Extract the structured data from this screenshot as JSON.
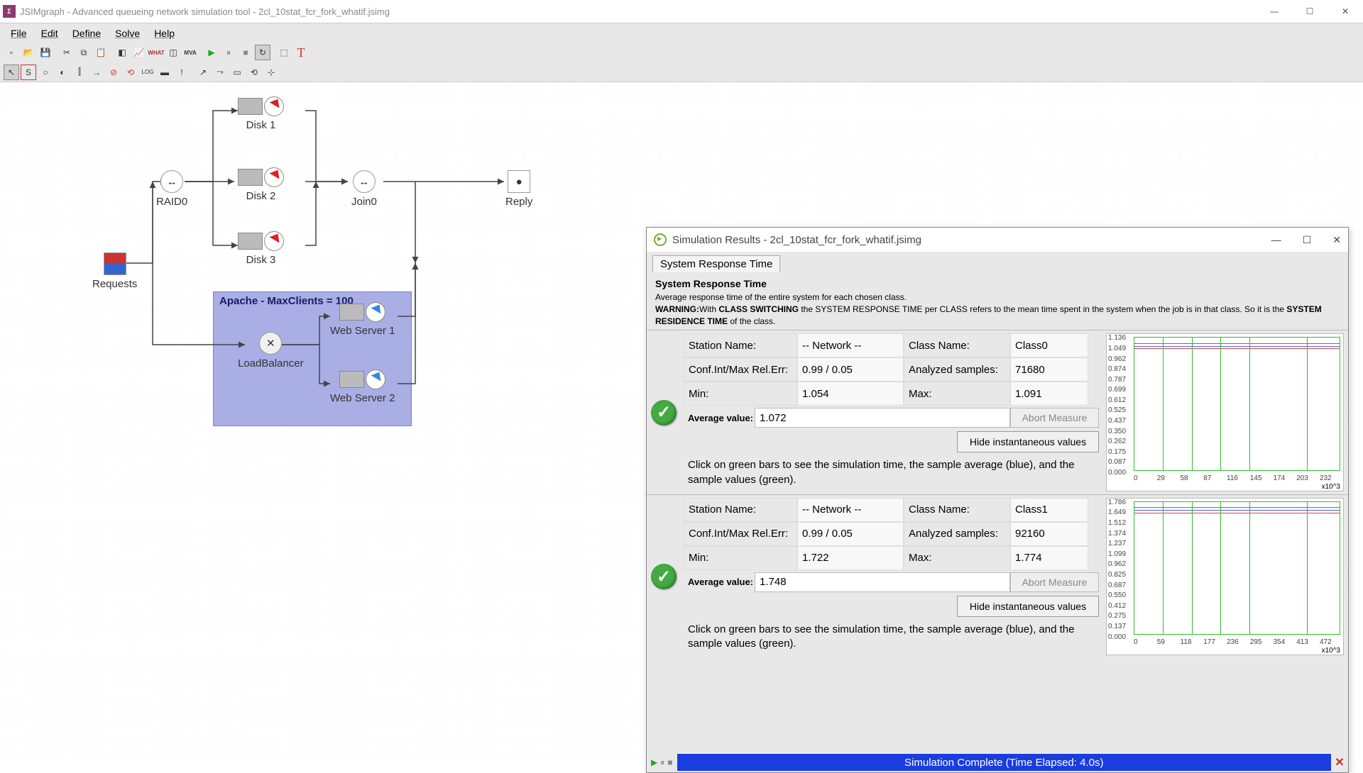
{
  "app": {
    "title": "JSIMgraph - Advanced queueing network simulation tool - 2cl_10stat_fcr_fork_whatif.jsimg"
  },
  "menu": [
    "File",
    "Edit",
    "Define",
    "Solve",
    "Help"
  ],
  "toolbar1": [
    "new",
    "open",
    "save",
    "|",
    "cut",
    "copy",
    "paste",
    "|",
    "r1",
    "r2",
    "what",
    "r3",
    "mva",
    "|",
    "play",
    "pause",
    "stop",
    "refresh",
    "|",
    "t1",
    "T"
  ],
  "toolbar2": [
    "select",
    "src",
    "srv",
    "q",
    "d",
    "fork",
    "join",
    "nop",
    "log",
    "sink",
    "|",
    "l1",
    "l2",
    "l3",
    "l4",
    "l5"
  ],
  "model": {
    "requests": "Requests",
    "raid": "RAID0",
    "disk1": "Disk 1",
    "disk2": "Disk 2",
    "disk3": "Disk 3",
    "join": "Join0",
    "reply": "Reply",
    "region": "Apache - MaxClients = 100",
    "lb": "LoadBalancer",
    "ws1": "Web Server 1",
    "ws2": "Web Server 2"
  },
  "dialog": {
    "title": "Simulation Results - 2cl_10stat_fcr_fork_whatif.jsimg",
    "tab": "System Response Time",
    "heading": "System Response Time",
    "desc": "Average response time of the entire system for each chosen class.",
    "warn_lbl": "WARNING:",
    "warn_pre": "With ",
    "warn_bold1": "CLASS SWITCHING",
    "warn_mid": " the SYSTEM RESPONSE TIME per CLASS refers to the mean time spent in the system when the job is in that class. So it is the ",
    "warn_bold2": "SYSTEM RESIDENCE TIME",
    "warn_post": " of the class.",
    "lbl_station": "Station Name:",
    "lbl_class": "Class Name:",
    "lbl_conf": "Conf.Int/Max Rel.Err:",
    "lbl_samples": "Analyzed samples:",
    "lbl_min": "Min:",
    "lbl_max": "Max:",
    "lbl_avg": "Average value:",
    "abort": "Abort Measure",
    "hide": "Hide instantaneous values",
    "hint": "Click on green bars to see the simulation time, the sample average (blue), and the sample values (green).",
    "status": "Simulation Complete (Time Elapsed: 4.0s)"
  },
  "measures": [
    {
      "station": "-- Network --",
      "class": "Class0",
      "conf": "0.99 / 0.05",
      "samples": "71680",
      "min": "1.054",
      "max": "1.091",
      "avg": "1.072",
      "yticks": [
        "1.136",
        "1.049",
        "0.962",
        "0.874",
        "0.787",
        "0.699",
        "0.612",
        "0.525",
        "0.437",
        "0.350",
        "0.262",
        "0.175",
        "0.087",
        "0.000"
      ],
      "xticks": [
        "0",
        "29",
        "58",
        "87",
        "116",
        "145",
        "174",
        "203",
        "232"
      ],
      "xexp": "x10^3"
    },
    {
      "station": "-- Network --",
      "class": "Class1",
      "conf": "0.99 / 0.05",
      "samples": "92160",
      "min": "1.722",
      "max": "1.774",
      "avg": "1.748",
      "yticks": [
        "1.786",
        "1.649",
        "1.512",
        "1.374",
        "1.237",
        "1.099",
        "0.962",
        "0.825",
        "0.687",
        "0.550",
        "0.412",
        "0.275",
        "0.137",
        "0.000"
      ],
      "xticks": [
        "0",
        "59",
        "118",
        "177",
        "236",
        "295",
        "354",
        "413",
        "472"
      ],
      "xexp": "x10^3"
    }
  ],
  "chart_data": [
    {
      "type": "line",
      "title": "System Response Time Class0",
      "ylim": [
        0,
        1.136
      ],
      "xlim": [
        0,
        232000
      ],
      "series": [
        {
          "name": "avg",
          "values": [
            1.072
          ]
        },
        {
          "name": "min",
          "values": [
            1.054
          ]
        },
        {
          "name": "max",
          "values": [
            1.091
          ]
        }
      ]
    },
    {
      "type": "line",
      "title": "System Response Time Class1",
      "ylim": [
        0,
        1.786
      ],
      "xlim": [
        0,
        472000
      ],
      "series": [
        {
          "name": "avg",
          "values": [
            1.748
          ]
        },
        {
          "name": "min",
          "values": [
            1.722
          ]
        },
        {
          "name": "max",
          "values": [
            1.774
          ]
        }
      ]
    }
  ]
}
